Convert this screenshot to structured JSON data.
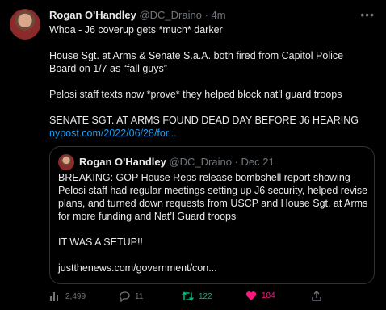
{
  "tweet": {
    "author_name": "Rogan O'Handley",
    "author_handle": "@DC_Draino",
    "separator": "·",
    "time": "4m",
    "lines": {
      "l1": "Whoa - J6 coverup gets *much* darker",
      "l2": "House Sgt. at Arms & Senate S.a.A. both fired from Capitol Police Board on 1/7 as “fall guys”",
      "l3": "Pelosi staff texts now *prove* they helped block nat’l guard troops",
      "l4": "SENATE SGT. AT ARMS FOUND DEAD DAY BEFORE J6 HEARING",
      "link": "nypost.com/2022/06/28/for..."
    }
  },
  "quoted_tweet": {
    "author_name": "Rogan O'Handley",
    "author_handle": "@DC_Draino",
    "separator": "·",
    "time": "Dec 21",
    "lines": {
      "l1": "BREAKING: GOP House Reps release bombshell report showing Pelosi staff had regular meetings setting up J6 security, helped revise plans, and turned down requests from USCP and House Sgt. at Arms for more funding and Nat’l Guard troops",
      "l2": "IT WAS A SETUP!!",
      "l3": "justthenews.com/government/con..."
    }
  },
  "actions": {
    "views": "2,499",
    "replies": "11",
    "retweets": "122",
    "likes": "184"
  },
  "colors": {
    "background": "#000000",
    "text": "#e7e9ea",
    "muted": "#71767b",
    "link": "#1d9bf0",
    "retweet_active": "#00ba7c",
    "like_active": "#f91880",
    "border": "#2f3336"
  },
  "icons": [
    "more-icon",
    "analytics-icon",
    "reply-icon",
    "retweet-icon",
    "heart-icon",
    "share-icon"
  ]
}
